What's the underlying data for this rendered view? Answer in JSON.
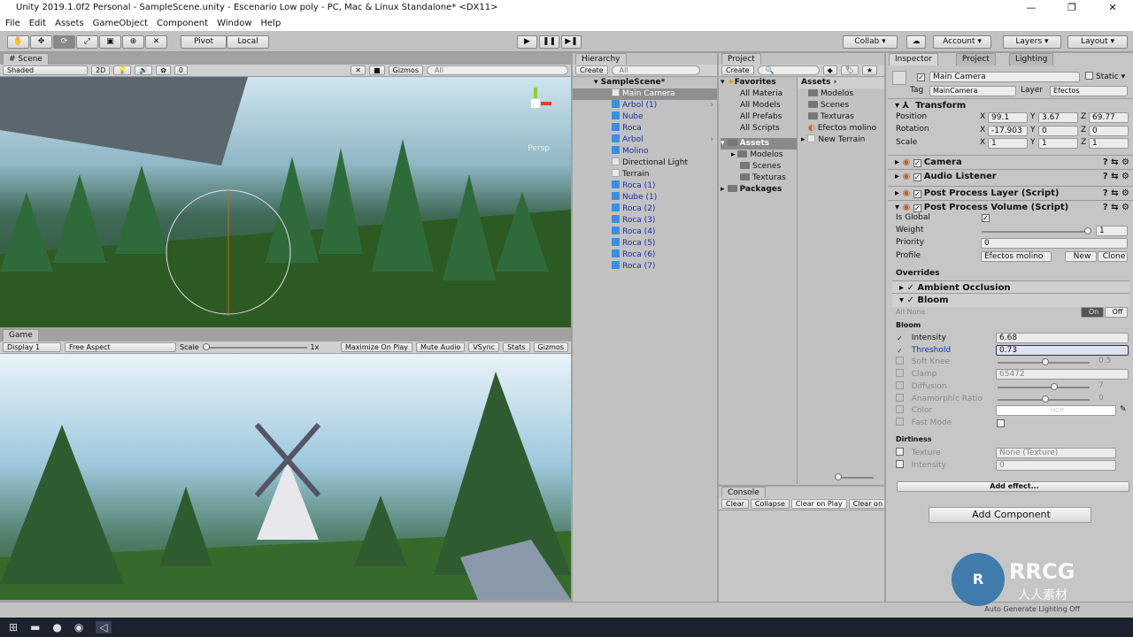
{
  "window": {
    "title": "Unity 2019.1.0f2 Personal - SampleScene.unity - Escenario Low poly - PC, Mac & Linux Standalone* <DX11>",
    "min": "—",
    "max": "❐",
    "close": "✕"
  },
  "menu": [
    "File",
    "Edit",
    "Assets",
    "GameObject",
    "Component",
    "Window",
    "Help"
  ],
  "toolbar": {
    "pivot": "Pivot",
    "local": "Local",
    "collab": "Collab ▾",
    "account": "Account ▾",
    "layers": "Layers ▾",
    "layout": "Layout ▾"
  },
  "scene": {
    "tab": "# Scene",
    "shading": "Shaded",
    "mode2d": "2D",
    "fx": "0",
    "gizmos": "Gizmos",
    "search": "All",
    "persp": "Persp"
  },
  "game": {
    "tab": "Game",
    "display": "Display 1",
    "aspect": "Free Aspect",
    "scale_label": "Scale",
    "scale_value": "1x",
    "scale_fraction": 0.0,
    "maximize": "Maximize On Play",
    "mute": "Mute Audio",
    "vsync": "VSync",
    "stats": "Stats",
    "gizmos": "Gizmos"
  },
  "hierarchy": {
    "tab": "Hierarchy",
    "create": "Create",
    "search": "All",
    "scene": "SampleScene*",
    "items": [
      {
        "label": "Main Camera",
        "type": "g",
        "selected": true
      },
      {
        "label": "Arbol (1)",
        "type": "b",
        "arrow": true
      },
      {
        "label": "Nube",
        "type": "b"
      },
      {
        "label": "Roca",
        "type": "b"
      },
      {
        "label": "Arbol",
        "type": "b",
        "arrow": true
      },
      {
        "label": "Molino",
        "type": "b"
      },
      {
        "label": "Directional Light",
        "type": "g"
      },
      {
        "label": "Terrain",
        "type": "g"
      },
      {
        "label": "Roca (1)",
        "type": "b"
      },
      {
        "label": "Nube (1)",
        "type": "b"
      },
      {
        "label": "Roca (2)",
        "type": "b"
      },
      {
        "label": "Roca (3)",
        "type": "b"
      },
      {
        "label": "Roca (4)",
        "type": "b"
      },
      {
        "label": "Roca (5)",
        "type": "b"
      },
      {
        "label": "Roca (6)",
        "type": "b"
      },
      {
        "label": "Roca (7)",
        "type": "b"
      }
    ]
  },
  "project": {
    "tab": "Project",
    "create": "Create",
    "favorites": "Favorites",
    "fav_items": [
      "All Materia",
      "All Models",
      "All Prefabs",
      "All Scripts"
    ],
    "assets": "Assets",
    "asset_folders": [
      "Modelos",
      "Scenes",
      "Texturas"
    ],
    "packages": "Packages",
    "breadcrumb": "Assets ›",
    "contents": [
      "Modelos",
      "Scenes",
      "Texturas",
      "Efectos molino",
      "New Terrain"
    ]
  },
  "console": {
    "tab": "Console",
    "clear": "Clear",
    "collapse": "Collapse",
    "clear_on_play": "Clear on Play",
    "clear_on_build": "Clear on B"
  },
  "inspector": {
    "tab": "Inspector",
    "project_tab": "Project",
    "lighting_tab": "Lighting",
    "name": "Main Camera",
    "static": "Static",
    "tag_label": "Tag",
    "tag": "MainCamera",
    "layer_label": "Layer",
    "layer": "Efectos",
    "transform": {
      "title": "Transform",
      "position_label": "Position",
      "rotation_label": "Rotation",
      "scale_label": "Scale",
      "position": [
        "99.1",
        "3.67",
        "69.77"
      ],
      "rotation": [
        "-17.903",
        "0",
        "0"
      ],
      "scale": [
        "1",
        "1",
        "1"
      ],
      "x": "X",
      "y": "Y",
      "z": "Z"
    },
    "components": [
      "Camera",
      "Audio Listener",
      "Post Process Layer (Script)",
      "Post Process Volume (Script)"
    ],
    "volume": {
      "is_global_label": "Is Global",
      "weight_label": "Weight",
      "weight": "1",
      "weight_fraction": 1.0,
      "priority_label": "Priority",
      "priority": "0",
      "profile_label": "Profile",
      "profile": "Efectos molino",
      "new": "New",
      "clone": "Clone",
      "overrides": "Overrides"
    },
    "effects": {
      "ao": "Ambient Occlusion",
      "bloom": "Bloom",
      "all": "All",
      "none": "None",
      "on": "On",
      "off": "Off",
      "section_bloom": "Bloom",
      "params": [
        {
          "label": "Intensity",
          "value": "6.68",
          "checked": true
        },
        {
          "label": "Threshold",
          "value": "0.73",
          "checked": true,
          "active": true
        },
        {
          "label": "Soft Knee",
          "value": "0.5",
          "slider": 0.5
        },
        {
          "label": "Clamp",
          "value": "65472"
        },
        {
          "label": "Diffusion",
          "value": "7",
          "slider": 0.6
        },
        {
          "label": "Anamorphic Ratio",
          "value": "0",
          "slider": 0.5
        },
        {
          "label": "Color",
          "value": "HDR"
        },
        {
          "label": "Fast Mode",
          "value": ""
        }
      ],
      "section_dirt": "Dirtiness",
      "dirt_texture_label": "Texture",
      "dirt_texture": "None (Texture)",
      "dirt_intensity_label": "Intensity",
      "dirt_intensity": "0",
      "add_effect": "Add effect..."
    },
    "add_component": "Add Component"
  },
  "status": {
    "auto": "Auto Generate Lighting Off"
  },
  "watermark": {
    "brand": "RRCG",
    "sub": "人人素材"
  }
}
